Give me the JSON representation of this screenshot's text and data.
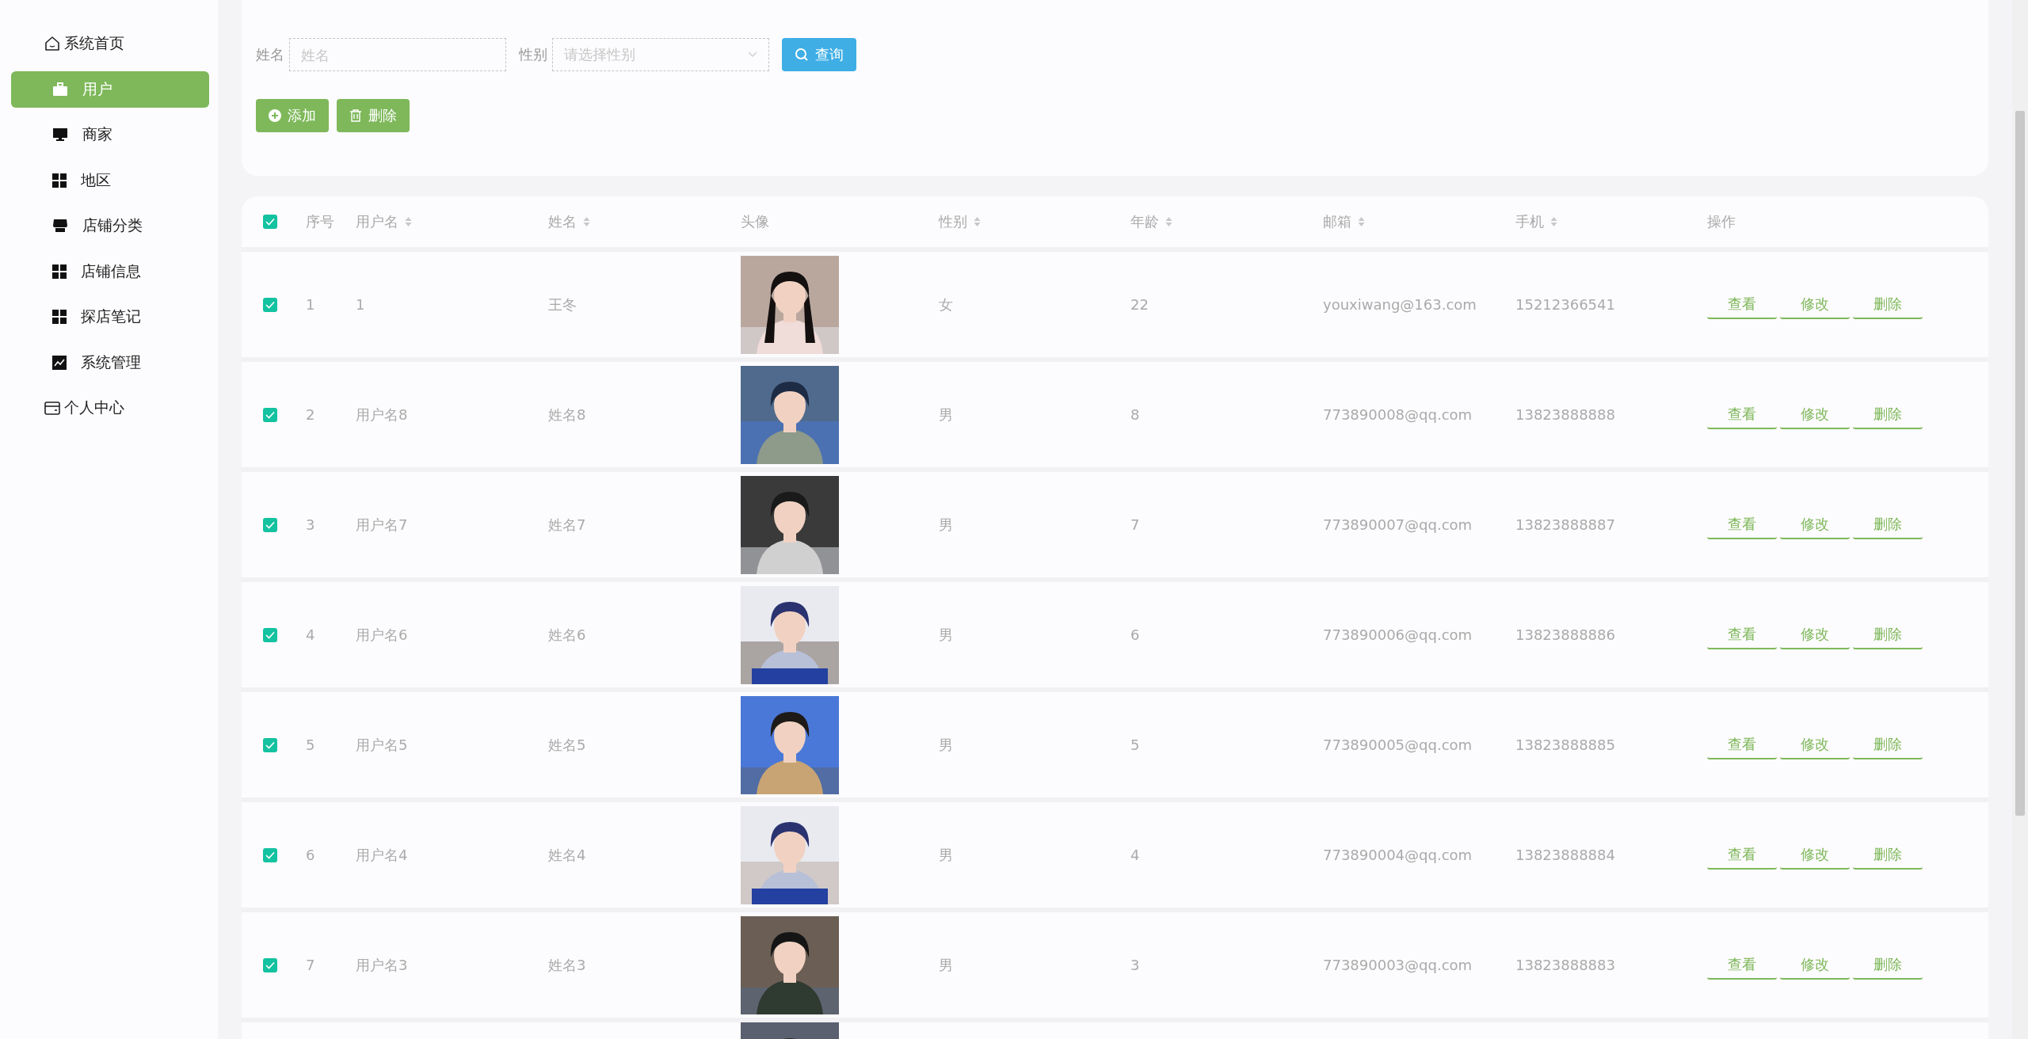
{
  "sidebar": {
    "items": [
      {
        "label": "系统首页",
        "kind": "top",
        "selected": false
      },
      {
        "label": "用户",
        "kind": "sub",
        "selected": true
      },
      {
        "label": "商家",
        "kind": "sub",
        "selected": false
      },
      {
        "label": "地区",
        "kind": "sub",
        "selected": false
      },
      {
        "label": "店铺分类",
        "kind": "sub",
        "selected": false
      },
      {
        "label": "店铺信息",
        "kind": "sub",
        "selected": false
      },
      {
        "label": "探店笔记",
        "kind": "sub",
        "selected": false
      },
      {
        "label": "系统管理",
        "kind": "sub",
        "selected": false
      },
      {
        "label": "个人中心",
        "kind": "top",
        "selected": false
      }
    ]
  },
  "search": {
    "fields": [
      {
        "label": "姓名",
        "placeholder": "姓名",
        "kind": "input"
      },
      {
        "label": "性别",
        "placeholder": "请选择性别",
        "kind": "select"
      }
    ],
    "query_button": "查询",
    "actions": [
      {
        "label": "添加",
        "kind": "add"
      },
      {
        "label": "删除",
        "kind": "delete"
      }
    ]
  },
  "table": {
    "all_checked": true,
    "columns": [
      {
        "label": "序号",
        "sortable": false
      },
      {
        "label": "用户名",
        "sortable": true
      },
      {
        "label": "姓名",
        "sortable": true
      },
      {
        "label": "头像",
        "sortable": false
      },
      {
        "label": "性别",
        "sortable": true
      },
      {
        "label": "年龄",
        "sortable": true
      },
      {
        "label": "邮箱",
        "sortable": true
      },
      {
        "label": "手机",
        "sortable": true
      },
      {
        "label": "操作",
        "sortable": false
      }
    ],
    "rows": [
      {
        "checked": true,
        "index": "1",
        "username": "1",
        "name": "王冬",
        "gender": "女",
        "age": "22",
        "email": "youxiwang@163.com",
        "phone": "15212366541",
        "actions": [
          "查看",
          "修改",
          "删除"
        ]
      },
      {
        "checked": true,
        "index": "2",
        "username": "用户名8",
        "name": "姓名8",
        "gender": "男",
        "age": "8",
        "email": "773890008@qq.com",
        "phone": "13823888888",
        "actions": [
          "查看",
          "修改",
          "删除"
        ]
      },
      {
        "checked": true,
        "index": "3",
        "username": "用户名7",
        "name": "姓名7",
        "gender": "男",
        "age": "7",
        "email": "773890007@qq.com",
        "phone": "13823888887",
        "actions": [
          "查看",
          "修改",
          "删除"
        ]
      },
      {
        "checked": true,
        "index": "4",
        "username": "用户名6",
        "name": "姓名6",
        "gender": "男",
        "age": "6",
        "email": "773890006@qq.com",
        "phone": "13823888886",
        "actions": [
          "查看",
          "修改",
          "删除"
        ]
      },
      {
        "checked": true,
        "index": "5",
        "username": "用户名5",
        "name": "姓名5",
        "gender": "男",
        "age": "5",
        "email": "773890005@qq.com",
        "phone": "13823888885",
        "actions": [
          "查看",
          "修改",
          "删除"
        ]
      },
      {
        "checked": true,
        "index": "6",
        "username": "用户名4",
        "name": "姓名4",
        "gender": "男",
        "age": "4",
        "email": "773890004@qq.com",
        "phone": "13823888884",
        "actions": [
          "查看",
          "修改",
          "删除"
        ]
      },
      {
        "checked": true,
        "index": "7",
        "username": "用户名3",
        "name": "姓名3",
        "gender": "男",
        "age": "3",
        "email": "773890003@qq.com",
        "phone": "13823888883",
        "actions": [
          "查看",
          "修改",
          "删除"
        ]
      }
    ]
  }
}
